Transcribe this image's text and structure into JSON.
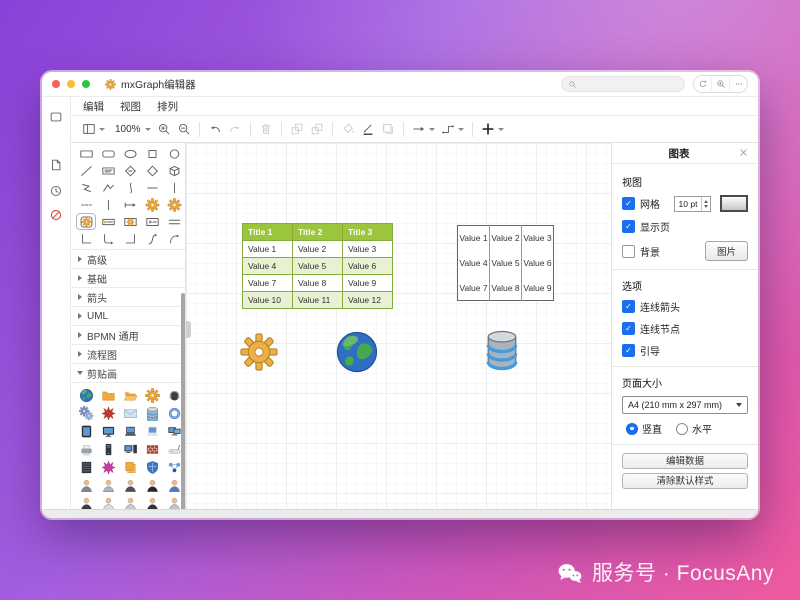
{
  "background": {
    "watermark": {
      "icon": "wechat-icon",
      "text": "服务号 · FocusAny"
    },
    "gradient": [
      "#8a41d8",
      "#a55fe0",
      "#d157b8",
      "#ef5a9e"
    ]
  },
  "window": {
    "title": "mxGraph编辑器",
    "title_icon": "gear-app-icon",
    "traffic_lights": [
      {
        "name": "close-button",
        "color": "#ff5f57"
      },
      {
        "name": "minimize-button",
        "color": "#febc2e"
      },
      {
        "name": "maximize-button",
        "color": "#28c840"
      }
    ],
    "search": {
      "icon": "search-icon",
      "value": ""
    },
    "controls": [
      {
        "icon": "refresh-icon",
        "name": "refresh-button"
      },
      {
        "icon": "zoom-in-icon",
        "name": "page-zoom-button"
      },
      {
        "icon": "more-icon",
        "name": "more-button"
      }
    ],
    "menus": [
      {
        "label": "编辑"
      },
      {
        "label": "视图"
      },
      {
        "label": "排列"
      }
    ],
    "toolbar": {
      "zoom": "100%",
      "items": [
        {
          "icon": "page-view-icon",
          "caret": true,
          "name": "view-mode-button"
        },
        {
          "zoom": true,
          "caret": true,
          "name": "zoom-level-select"
        },
        {
          "icon": "zoom-in-icon",
          "name": "zoom-in-button"
        },
        {
          "icon": "zoom-out-icon",
          "name": "zoom-out-button"
        },
        {
          "sep": true
        },
        {
          "icon": "undo-icon",
          "name": "undo-button"
        },
        {
          "icon": "redo-icon",
          "disabled": true,
          "name": "redo-button"
        },
        {
          "sep": true
        },
        {
          "icon": "delete-icon",
          "disabled": true,
          "name": "delete-button"
        },
        {
          "sep": true
        },
        {
          "icon": "to-front-icon",
          "disabled": true,
          "name": "to-front-button"
        },
        {
          "icon": "to-back-icon",
          "disabled": true,
          "name": "to-back-button"
        },
        {
          "sep": true
        },
        {
          "icon": "fill-color-icon",
          "disabled": true,
          "name": "fill-color-button"
        },
        {
          "icon": "line-color-icon",
          "name": "line-color-button"
        },
        {
          "icon": "shadow-icon",
          "disabled": true,
          "name": "shadow-button"
        },
        {
          "sep": true
        },
        {
          "icon": "connection-icon",
          "caret": true,
          "name": "connection-style-button"
        },
        {
          "icon": "waypoints-icon",
          "caret": true,
          "name": "waypoint-style-button"
        },
        {
          "sep": true
        },
        {
          "icon": "insert-icon",
          "caret": true,
          "name": "insert-button"
        }
      ]
    }
  },
  "rail": {
    "items": [
      {
        "icon": "window-icon"
      },
      {
        "icon": "file-icon"
      },
      {
        "icon": "history-icon"
      },
      {
        "icon": "blocked-icon"
      }
    ]
  },
  "palette": {
    "shape_rows": [
      [
        "rectangle",
        "rounded-rectangle",
        "ellipse",
        "square",
        "circle"
      ],
      [
        "line",
        "text-box",
        "diamond-label",
        "diamond",
        "cube"
      ],
      [
        "zigzag",
        "polyline",
        "vertical-curve",
        "horizontal-line",
        "vertical-line"
      ],
      [
        "dashed-line",
        "vertical-line",
        "arrow-connector",
        "gear",
        "gear"
      ],
      [
        "gear-container",
        "label",
        "gear-box",
        "arrow-box",
        "double-line"
      ],
      [
        "corner",
        "rounded-corner",
        "corner-reverse",
        "s-curve",
        "curved-arrow"
      ]
    ],
    "selected_cell": {
      "row": 4,
      "col": 0
    },
    "sections": [
      {
        "label": "高级",
        "expanded": false
      },
      {
        "label": "基础",
        "expanded": false
      },
      {
        "label": "箭头",
        "expanded": false
      },
      {
        "label": "UML",
        "expanded": false
      },
      {
        "label": "BPMN 通用",
        "expanded": false
      },
      {
        "label": "流程图",
        "expanded": false
      },
      {
        "label": "剪贴画",
        "expanded": true
      }
    ],
    "clipart_rows": [
      [
        "globe",
        "folder",
        "folder-open",
        "gear-clip",
        "headset"
      ],
      [
        "gears",
        "burst",
        "mail",
        "server",
        "network"
      ],
      [
        "tablet",
        "monitor",
        "laptop",
        "laptop-light",
        "dual-monitor"
      ],
      [
        "printer",
        "tower",
        "workstation",
        "firewall",
        "router"
      ],
      [
        "rack",
        "virus",
        "copy",
        "shield",
        "cloud-network"
      ],
      [
        "person:#7d8a99",
        "person:#aab6c2",
        "person:#4a5159",
        "person:#23282e",
        "person:#4f7fc0"
      ],
      [
        "person:#363c46",
        "person:#d9dee3",
        "person:#c7ccd2",
        "person:#2e333b",
        "person:#bfc8d0"
      ]
    ]
  },
  "canvas": {
    "styled_table": {
      "headers": [
        "Title 1",
        "Title 2",
        "Title 3"
      ],
      "rows": [
        [
          "Value 1",
          "Value 2",
          "Value 3"
        ],
        [
          "Value 4",
          "Value 5",
          "Value 6"
        ],
        [
          "Value 7",
          "Value 8",
          "Value 9"
        ],
        [
          "Value 10",
          "Value 11",
          "Value 12"
        ]
      ],
      "header_bg": "#9bc53d",
      "header_text": "#ffffff",
      "alt_row_bg": "#e9f1d3",
      "row_bg": "#ffffff",
      "border": "#86ab3f"
    },
    "plain_table": {
      "rows": [
        [
          "Value 1",
          "Value 2",
          "Value 3"
        ],
        [
          "Value 4",
          "Value 5",
          "Value 6"
        ],
        [
          "Value 7",
          "Value 8",
          "Value 9"
        ]
      ],
      "border": "#666666"
    },
    "shapes": [
      {
        "icon": "gear-shape"
      },
      {
        "icon": "globe-shape"
      },
      {
        "icon": "database-shape"
      }
    ]
  },
  "panel": {
    "title": "图表",
    "close_icon": "close-icon",
    "view": {
      "label": "视图",
      "grid": {
        "label": "网格",
        "checked": true,
        "value": "10 pt"
      },
      "page": {
        "label": "显示页",
        "checked": true
      },
      "background": {
        "label": "背景",
        "checked": false,
        "button": "图片"
      }
    },
    "options": {
      "label": "选项",
      "items": [
        {
          "label": "连线箭头",
          "checked": true
        },
        {
          "label": "连线节点",
          "checked": true
        },
        {
          "label": "引导",
          "checked": true
        }
      ]
    },
    "page_size": {
      "label": "页面大小",
      "value": "A4 (210 mm x 297 mm)",
      "orientations": [
        {
          "label": "竖直",
          "selected": true
        },
        {
          "label": "水平",
          "selected": false
        }
      ]
    },
    "actions": [
      {
        "label": "编辑数据"
      },
      {
        "label": "清除默认样式"
      }
    ],
    "accent": "#1a6ff0"
  }
}
